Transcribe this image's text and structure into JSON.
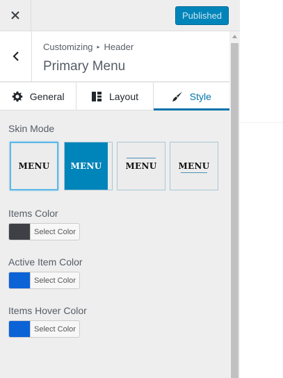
{
  "topbar": {
    "close_icon": "close-icon",
    "publish_label": "Published"
  },
  "header": {
    "breadcrumb_root": "Customizing",
    "breadcrumb_section": "Header",
    "title": "Primary Menu"
  },
  "tabs": [
    {
      "label": "General",
      "icon": "gear-icon",
      "active": false
    },
    {
      "label": "Layout",
      "icon": "layout-icon",
      "active": false
    },
    {
      "label": "Style",
      "icon": "brush-icon",
      "active": true
    }
  ],
  "skin_mode": {
    "label": "Skin Mode",
    "options": [
      {
        "text": "MENU",
        "style": "plain",
        "selected": true
      },
      {
        "text": "MENU",
        "style": "filled",
        "selected": false
      },
      {
        "text": "MENU",
        "style": "overline",
        "selected": false
      },
      {
        "text": "MENU",
        "style": "underline",
        "selected": false
      }
    ]
  },
  "colors": [
    {
      "label": "Items Color",
      "button_label": "Select Color",
      "value": "#3f4046"
    },
    {
      "label": "Active Item Color",
      "button_label": "Select Color",
      "value": "#0b63d6"
    },
    {
      "label": "Items Hover Color",
      "button_label": "Select Color",
      "value": "#0b63d6"
    }
  ],
  "theme": {
    "accent": "#0073aa",
    "publish_bg": "#0085ba"
  }
}
